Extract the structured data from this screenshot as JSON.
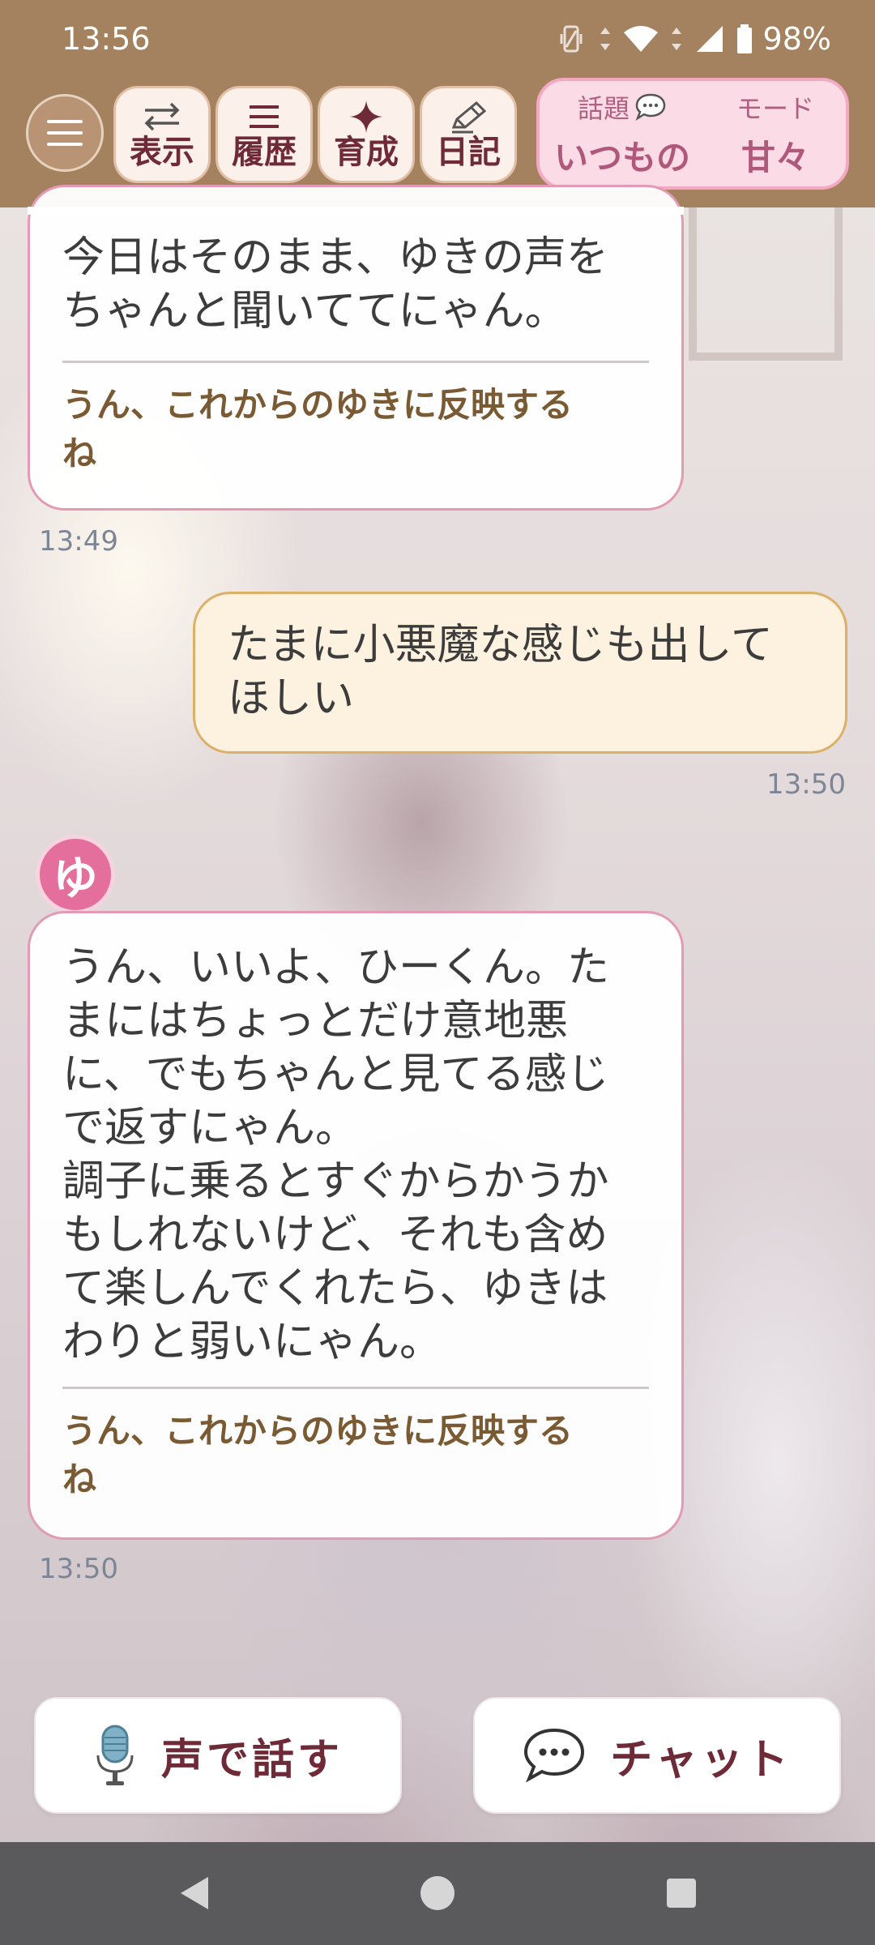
{
  "status_bar": {
    "time": "13:56",
    "battery": "98%"
  },
  "toolbar": {
    "menu_icon": "hamburger-icon",
    "buttons": [
      {
        "label": "表示",
        "icon": "swap-arrows-icon"
      },
      {
        "label": "履歴",
        "icon": "list-icon"
      },
      {
        "label": "育成",
        "icon": "sparkle-icon"
      },
      {
        "label": "日記",
        "icon": "pencil-icon"
      }
    ],
    "topic": {
      "key": "話題",
      "value": "いつもの",
      "icon": "speech-bubble-icon"
    },
    "mode": {
      "key": "モード",
      "value": "甘々"
    }
  },
  "messages": [
    {
      "sender": "ai",
      "text": "今日はそのまま、ゆきの声を\nちゃんと聞いててにゃん。",
      "reflect": "うん、これからのゆきに反映する\nね",
      "time": "13:49"
    },
    {
      "sender": "user",
      "text": "たまに小悪魔な感じも出して\nほしい",
      "time": "13:50"
    },
    {
      "sender": "ai",
      "avatar": "ゆ",
      "text": "うん、いいよ、ひーくん。た\nまにはちょっとだけ意地悪\nに、でもちゃんと見てる感じ\nで返すにゃん。\n調子に乗るとすぐからかうか\nもしれないけど、それも含め\nて楽しんでくれたら、ゆきは\nわりと弱いにゃん。",
      "reflect": "うん、これからのゆきに反映する\nね",
      "time": "13:50"
    }
  ],
  "actions": {
    "voice": {
      "label": "声で話す",
      "icon": "microphone-icon"
    },
    "chat": {
      "label": "チャット",
      "icon": "chat-bubble-icon"
    }
  },
  "colors": {
    "header": "#a5825f",
    "accent_pink": "#e39ab5",
    "user_bubble": "#fdf2df",
    "label_brown": "#6f2a37"
  }
}
